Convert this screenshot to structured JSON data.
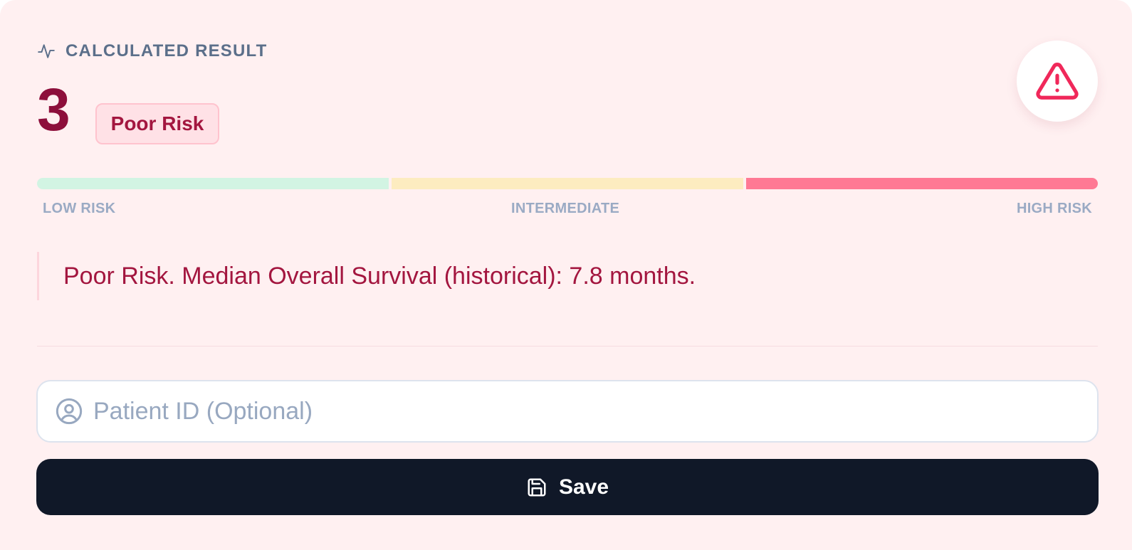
{
  "result": {
    "header_label": "CALCULATED RESULT",
    "score": "3",
    "risk_badge": "Poor Risk",
    "interpretation": "Poor Risk. Median Overall Survival (historical): 7.8 months."
  },
  "risk_scale": {
    "labels": [
      "LOW RISK",
      "INTERMEDIATE",
      "HIGH RISK"
    ],
    "active_segment": "HIGH RISK",
    "colors": {
      "low": "#d2f4e3",
      "intermediate": "#fdecc0",
      "high": "#ff7994"
    }
  },
  "patient_input": {
    "placeholder": "Patient ID (Optional)",
    "value": ""
  },
  "save_button": {
    "label": "Save"
  },
  "icons": {
    "header": "activity-icon",
    "alert": "alert-triangle-icon",
    "input": "user-circle-icon",
    "save": "save-icon"
  },
  "colors": {
    "card_background": "#fff0f1",
    "score": "#8d0f3b",
    "accent": "#a3163f",
    "alert": "#f0285a",
    "button": "#101828"
  }
}
